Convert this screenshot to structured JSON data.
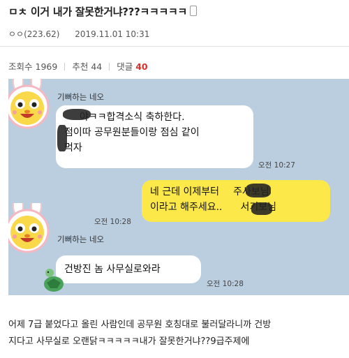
{
  "post": {
    "title": "ㅁㅊ 이거 내가 잘못한거냐???ㅋㅋㅋㅋㅋ",
    "author": "ㅇㅇ(223.62)",
    "date": "2019.11.01 10:31"
  },
  "stats": {
    "views_label": "조회수",
    "views": "1969",
    "recommend_label": "추천",
    "recommend": "44",
    "comments_label": "댓글",
    "comments": "40"
  },
  "chat": {
    "sender_name_1": "기뻐하는 네오",
    "msg1_line1": "야ㅋㅋ합격소식 축하한다.",
    "msg1_line2": "점이따 공무원분들이랑 점심 같이",
    "msg1_line3": "먹자",
    "time1": "오전 10:27",
    "reply_line1": "네 근데 이제부터",
    "reply_line1b": "주사보님",
    "reply_line2": "이라고 해주세요..",
    "reply_line2b": "서기보님",
    "time2": "오전 10:28",
    "sender_name_2": "기뻐하는 네오",
    "msg2": "건방진 놈 사무실로와라",
    "time3": "오전 10:28"
  },
  "caption": {
    "line1": "어제 7급 붙었다고 올린 사람인데 공무원 호칭대로 불러달라니까 건방",
    "line2": "지다고 사무실로 오랜닭ㅋㅋㅋㅋㅋ내가 잘못한거냐??9급주제에"
  },
  "colors": {
    "chat_bg": "#bacee0",
    "my_bubble": "#fde84a",
    "accent_red": "#d9302c"
  }
}
